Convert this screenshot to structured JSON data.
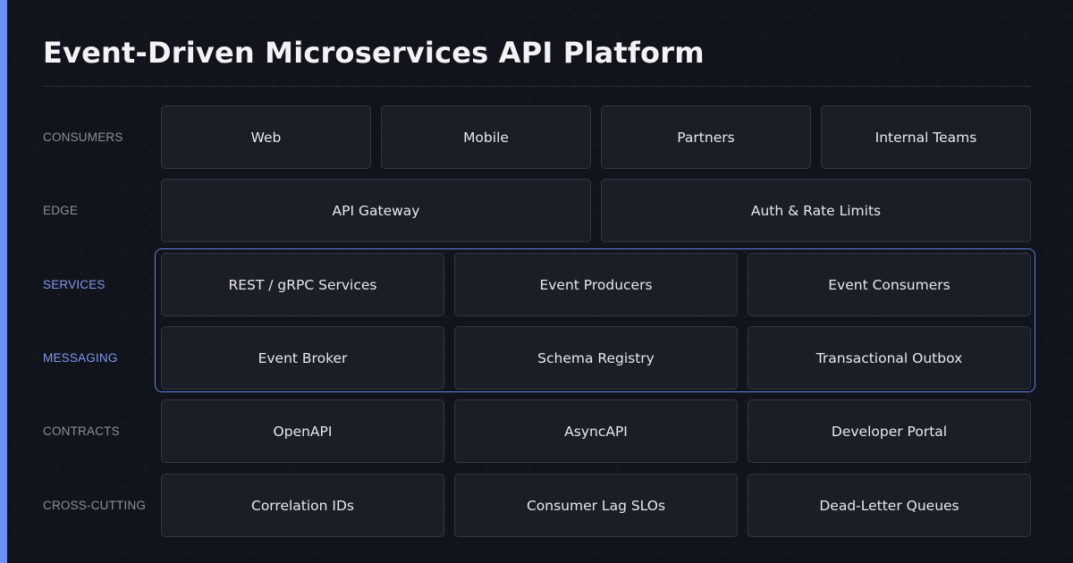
{
  "title": "Event-Driven Microservices API Platform",
  "layers": [
    {
      "label": "CONSUMERS",
      "highlighted": false,
      "boxes": [
        "Web",
        "Mobile",
        "Partners",
        "Internal Teams"
      ]
    },
    {
      "label": "EDGE",
      "highlighted": false,
      "boxes": [
        "API Gateway",
        "Auth & Rate Limits"
      ]
    },
    {
      "label": "SERVICES",
      "highlighted": true,
      "boxes": [
        "REST / gRPC Services",
        "Event Producers",
        "Event Consumers"
      ]
    },
    {
      "label": "MESSAGING",
      "highlighted": true,
      "boxes": [
        "Event Broker",
        "Schema Registry",
        "Transactional Outbox"
      ]
    },
    {
      "label": "CONTRACTS",
      "highlighted": false,
      "boxes": [
        "OpenAPI",
        "AsyncAPI",
        "Developer Portal"
      ]
    },
    {
      "label": "CROSS-CUTTING",
      "highlighted": false,
      "boxes": [
        "Correlation IDs",
        "Consumer Lag SLOs",
        "Dead-Letter Queues"
      ]
    }
  ],
  "colors": {
    "accent": "#6d8ff5",
    "background": "#11141b",
    "box_fill": "#1b1e27",
    "box_border": "#323745",
    "highlight_border": "#5f80ec"
  }
}
